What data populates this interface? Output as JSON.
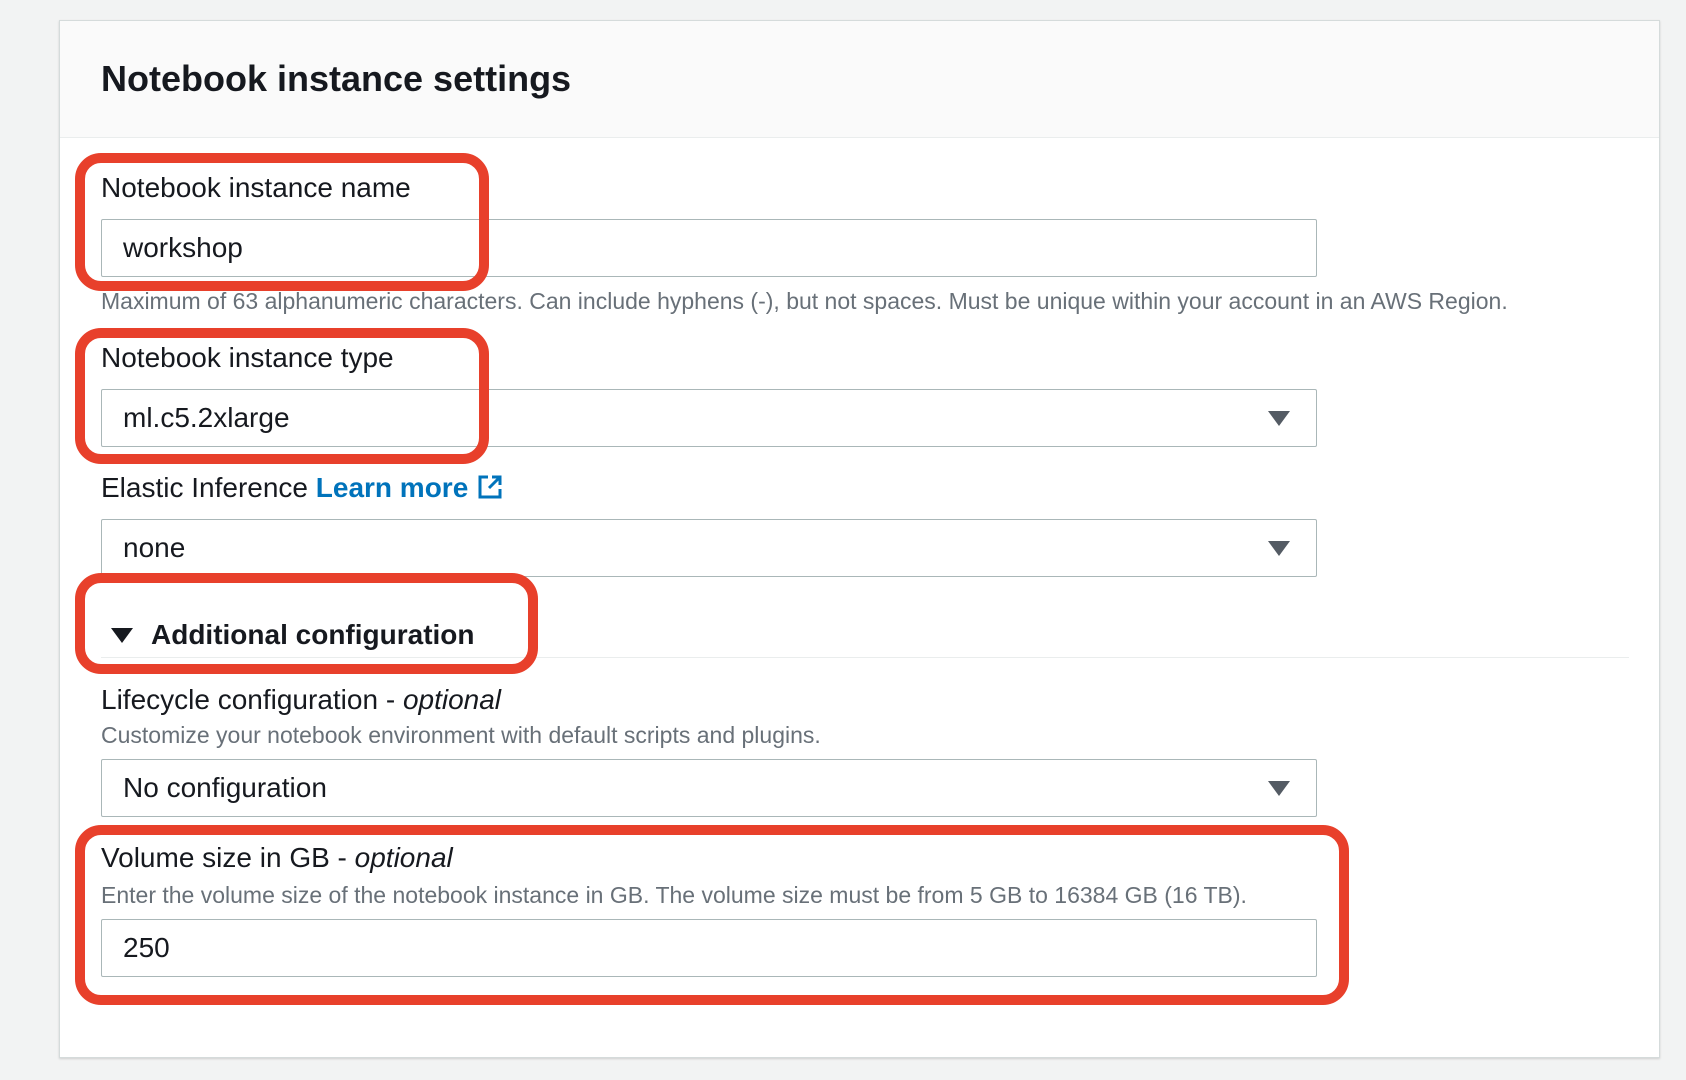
{
  "panel": {
    "title": "Notebook instance settings"
  },
  "instance_name": {
    "label": "Notebook instance name",
    "value": "workshop",
    "hint": "Maximum of 63 alphanumeric characters. Can include hyphens (-), but not spaces. Must be unique within your account in an AWS Region."
  },
  "instance_type": {
    "label": "Notebook instance type",
    "value": "ml.c5.2xlarge"
  },
  "elastic_inference": {
    "label": "Elastic Inference",
    "link_text": "Learn more",
    "value": "none"
  },
  "additional_configuration": {
    "label": "Additional configuration",
    "expanded": true
  },
  "lifecycle": {
    "label": "Lifecycle configuration - ",
    "optional": "optional",
    "hint": "Customize your notebook environment with default scripts and plugins.",
    "value": "No configuration"
  },
  "volume": {
    "label": "Volume size in GB - ",
    "optional": "optional",
    "hint": "Enter the volume size of the notebook instance in GB. The volume size must be from 5 GB to 16384 GB (16 TB).",
    "value": "250"
  },
  "icons": {
    "external_link": "external-link-icon",
    "dropdown": "caret-down-icon",
    "expand": "caret-down-icon"
  },
  "colors": {
    "link": "#0073bb",
    "highlight": "#e8402b",
    "hint_text": "#687078",
    "border": "#aab7b8"
  }
}
